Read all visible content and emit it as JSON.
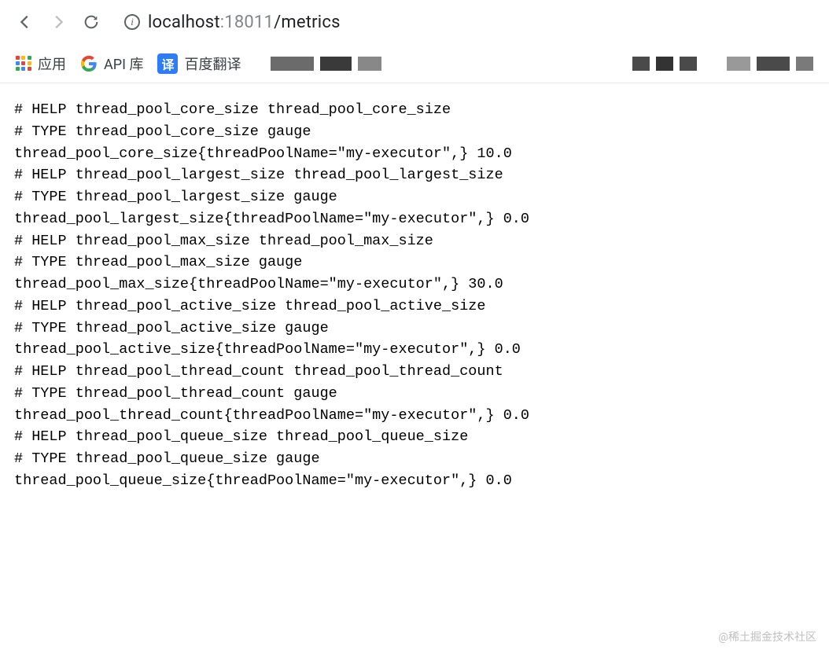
{
  "browser": {
    "url": {
      "host": "localhost",
      "port": ":18011",
      "path": "/metrics"
    }
  },
  "bookmarks": {
    "apps_label": "应用",
    "api_lib": "API 库",
    "baidu_translate": "百度翻译"
  },
  "metrics_text": "# HELP thread_pool_core_size thread_pool_core_size\n# TYPE thread_pool_core_size gauge\nthread_pool_core_size{threadPoolName=\"my-executor\",} 10.0\n# HELP thread_pool_largest_size thread_pool_largest_size\n# TYPE thread_pool_largest_size gauge\nthread_pool_largest_size{threadPoolName=\"my-executor\",} 0.0\n# HELP thread_pool_max_size thread_pool_max_size\n# TYPE thread_pool_max_size gauge\nthread_pool_max_size{threadPoolName=\"my-executor\",} 30.0\n# HELP thread_pool_active_size thread_pool_active_size\n# TYPE thread_pool_active_size gauge\nthread_pool_active_size{threadPoolName=\"my-executor\",} 0.0\n# HELP thread_pool_thread_count thread_pool_thread_count\n# TYPE thread_pool_thread_count gauge\nthread_pool_thread_count{threadPoolName=\"my-executor\",} 0.0\n# HELP thread_pool_queue_size thread_pool_queue_size\n# TYPE thread_pool_queue_size gauge\nthread_pool_queue_size{threadPoolName=\"my-executor\",} 0.0",
  "watermark": "@稀土掘金技术社区"
}
